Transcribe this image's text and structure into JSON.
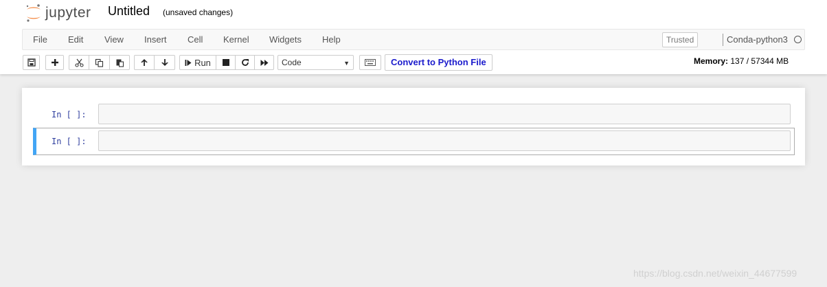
{
  "header": {
    "logo_text": "jupyter",
    "notebook_title": "Untitled",
    "save_status": "(unsaved changes)"
  },
  "menubar": {
    "items": [
      {
        "label": "File"
      },
      {
        "label": "Edit"
      },
      {
        "label": "View"
      },
      {
        "label": "Insert"
      },
      {
        "label": "Cell"
      },
      {
        "label": "Kernel"
      },
      {
        "label": "Widgets"
      },
      {
        "label": "Help"
      }
    ],
    "trusted_label": "Trusted",
    "kernel_name": "Conda-python3"
  },
  "toolbar": {
    "icons": {
      "save": "save-icon",
      "insert": "plus-icon",
      "cut": "cut-icon",
      "copy": "copy-icon",
      "paste": "paste-icon",
      "move_up": "arrow-up-icon",
      "move_down": "arrow-down-icon",
      "run": "step-forward-icon",
      "interrupt": "stop-icon",
      "restart": "refresh-icon",
      "restart_run_all": "fast-forward-icon",
      "command_palette": "keyboard-icon"
    },
    "run_label": "Run",
    "cell_type": "Code",
    "convert_label": "Convert to Python File",
    "memory_label": "Memory:",
    "memory_value": "137 / 57344 MB"
  },
  "cells": [
    {
      "prompt": "In [ ]:",
      "selected": false
    },
    {
      "prompt": "In [ ]:",
      "selected": true
    }
  ],
  "watermark": "https://blog.csdn.net/weixin_44677599",
  "colors": {
    "selected_cell_border": "#42a5f5",
    "prompt": "#303f9f",
    "convert_text": "#1a1acc",
    "logo_orange": "#f37726"
  }
}
